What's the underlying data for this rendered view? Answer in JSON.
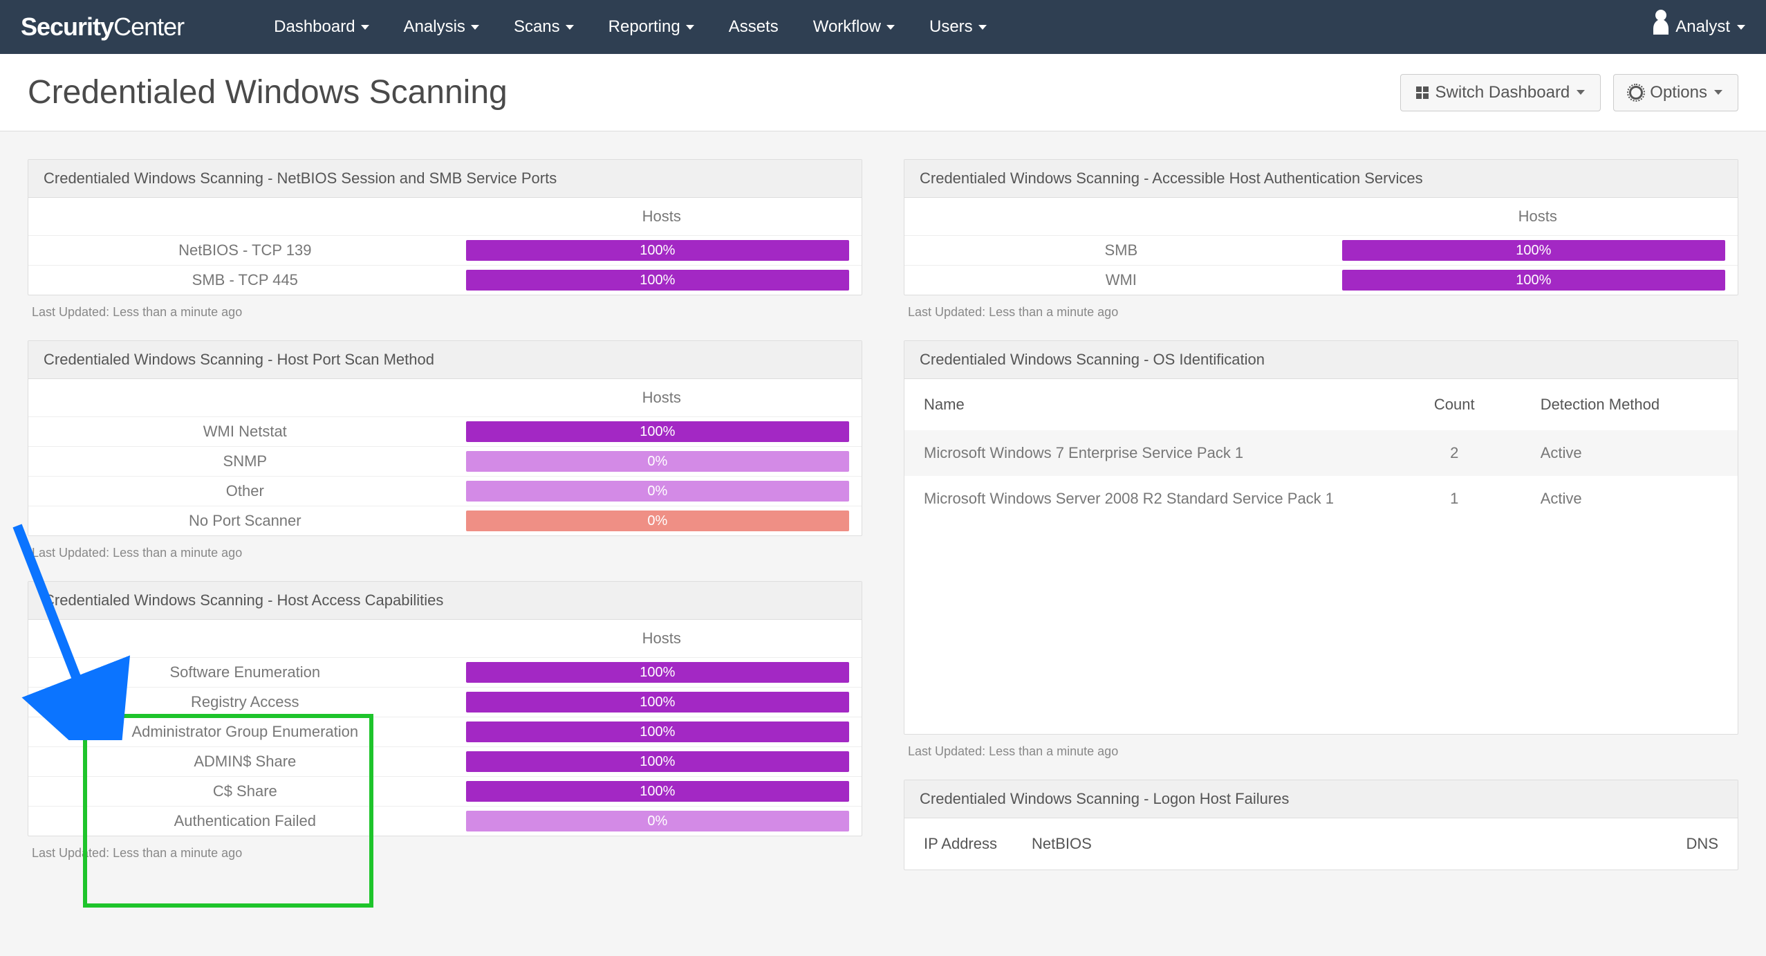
{
  "navbar": {
    "brand_bold": "Security",
    "brand_light": "Center",
    "items": [
      "Dashboard",
      "Analysis",
      "Scans",
      "Reporting",
      "Assets",
      "Workflow",
      "Users"
    ],
    "items_caret": [
      true,
      true,
      true,
      true,
      false,
      true,
      true
    ],
    "user_label": "Analyst"
  },
  "header": {
    "title": "Credentialed Windows Scanning",
    "switch_label": "Switch Dashboard",
    "options_label": "Options"
  },
  "panels": {
    "p1": {
      "title": "Credentialed Windows Scanning - NetBIOS Session and SMB Service Ports",
      "col_header": "Hosts",
      "rows": [
        {
          "label": "NetBIOS - TCP 139",
          "pct": "100%",
          "style": "purple"
        },
        {
          "label": "SMB - TCP 445",
          "pct": "100%",
          "style": "purple"
        }
      ],
      "updated": "Last Updated: Less than a minute ago"
    },
    "p2": {
      "title": "Credentialed Windows Scanning - Accessible Host Authentication Services",
      "col_header": "Hosts",
      "rows": [
        {
          "label": "SMB",
          "pct": "100%",
          "style": "purple"
        },
        {
          "label": "WMI",
          "pct": "100%",
          "style": "purple"
        }
      ],
      "updated": "Last Updated: Less than a minute ago"
    },
    "p3": {
      "title": "Credentialed Windows Scanning - Host Port Scan Method",
      "col_header": "Hosts",
      "rows": [
        {
          "label": "WMI Netstat",
          "pct": "100%",
          "style": "purple"
        },
        {
          "label": "SNMP",
          "pct": "0%",
          "style": "purple-light"
        },
        {
          "label": "Other",
          "pct": "0%",
          "style": "purple-light"
        },
        {
          "label": "No Port Scanner",
          "pct": "0%",
          "style": "salmon"
        }
      ],
      "updated": "Last Updated: Less than a minute ago"
    },
    "p4": {
      "title": "Credentialed Windows Scanning - OS Identification",
      "cols": [
        "Name",
        "Count",
        "Detection Method"
      ],
      "rows": [
        {
          "name": "Microsoft Windows 7 Enterprise Service Pack 1",
          "count": "2",
          "method": "Active"
        },
        {
          "name": "Microsoft Windows Server 2008 R2 Standard Service Pack 1",
          "count": "1",
          "method": "Active"
        }
      ],
      "updated": "Last Updated: Less than a minute ago"
    },
    "p5": {
      "title": "Credentialed Windows Scanning - Host Access Capabilities",
      "col_header": "Hosts",
      "rows": [
        {
          "label": "Software Enumeration",
          "pct": "100%",
          "style": "purple"
        },
        {
          "label": "Registry Access",
          "pct": "100%",
          "style": "purple"
        },
        {
          "label": "Administrator Group Enumeration",
          "pct": "100%",
          "style": "purple"
        },
        {
          "label": "ADMIN$ Share",
          "pct": "100%",
          "style": "purple"
        },
        {
          "label": "C$ Share",
          "pct": "100%",
          "style": "purple"
        },
        {
          "label": "Authentication Failed",
          "pct": "0%",
          "style": "purple-light"
        }
      ],
      "updated": "Last Updated: Less than a minute ago"
    },
    "p6": {
      "title": "Credentialed Windows Scanning - Logon Host Failures",
      "cols": [
        "IP Address",
        "NetBIOS",
        "DNS"
      ]
    }
  },
  "chart_data": [
    {
      "type": "bar",
      "title": "NetBIOS Session and SMB Service Ports",
      "categories": [
        "NetBIOS - TCP 139",
        "SMB - TCP 445"
      ],
      "values": [
        100,
        100
      ],
      "ylabel": "Hosts %",
      "ylim": [
        0,
        100
      ]
    },
    {
      "type": "bar",
      "title": "Accessible Host Authentication Services",
      "categories": [
        "SMB",
        "WMI"
      ],
      "values": [
        100,
        100
      ],
      "ylabel": "Hosts %",
      "ylim": [
        0,
        100
      ]
    },
    {
      "type": "bar",
      "title": "Host Port Scan Method",
      "categories": [
        "WMI Netstat",
        "SNMP",
        "Other",
        "No Port Scanner"
      ],
      "values": [
        100,
        0,
        0,
        0
      ],
      "ylabel": "Hosts %",
      "ylim": [
        0,
        100
      ]
    },
    {
      "type": "table",
      "title": "OS Identification",
      "columns": [
        "Name",
        "Count",
        "Detection Method"
      ],
      "rows": [
        [
          "Microsoft Windows 7 Enterprise Service Pack 1",
          2,
          "Active"
        ],
        [
          "Microsoft Windows Server 2008 R2 Standard Service Pack 1",
          1,
          "Active"
        ]
      ]
    },
    {
      "type": "bar",
      "title": "Host Access Capabilities",
      "categories": [
        "Software Enumeration",
        "Registry Access",
        "Administrator Group Enumeration",
        "ADMIN$ Share",
        "C$ Share",
        "Authentication Failed"
      ],
      "values": [
        100,
        100,
        100,
        100,
        100,
        0
      ],
      "ylabel": "Hosts %",
      "ylim": [
        0,
        100
      ]
    }
  ],
  "annotation": {
    "description": "Green rectangle highlighting Host Access Capabilities row labels, with a blue arrow pointing to it from the upper-left."
  }
}
